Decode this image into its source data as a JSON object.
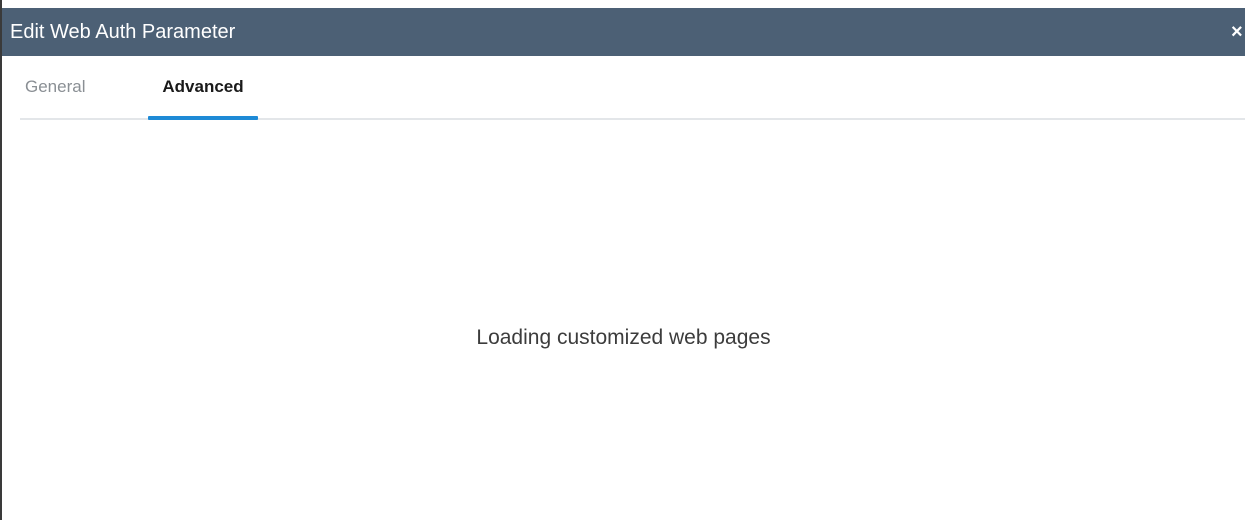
{
  "dialog": {
    "title": "Edit Web Auth Parameter",
    "close_label": "×"
  },
  "tabs": [
    {
      "label": "General",
      "active": false
    },
    {
      "label": "Advanced",
      "active": true
    }
  ],
  "content": {
    "status_text": "Loading customized web pages"
  },
  "colors": {
    "titlebar_bg": "#4c6075",
    "active_tab_underline": "#1e8ad6",
    "inactive_tab_text": "#8a8f94"
  }
}
